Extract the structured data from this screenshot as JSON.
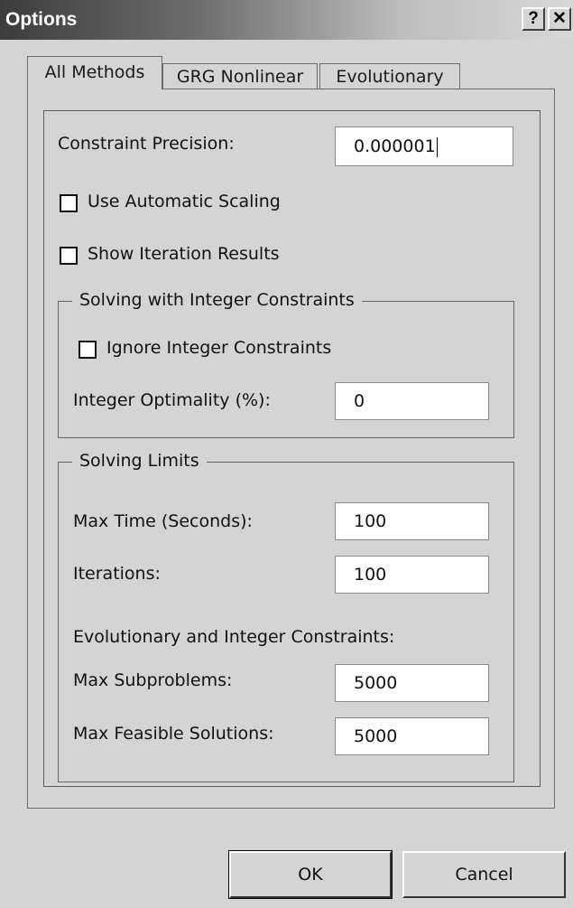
{
  "window": {
    "title": "Options",
    "help_btn": "?",
    "close_btn": "✕"
  },
  "tabs": [
    {
      "label": "All Methods",
      "active": true
    },
    {
      "label": "GRG Nonlinear",
      "active": false
    },
    {
      "label": "Evolutionary",
      "active": false
    }
  ],
  "constraint_precision": {
    "label": "Constraint Precision:",
    "value": "0.000001"
  },
  "checkboxes": {
    "use_automatic_scaling": {
      "label": "Use Automatic Scaling",
      "checked": false
    },
    "show_iteration_results": {
      "label": "Show Iteration Results",
      "checked": false
    }
  },
  "integer_group": {
    "legend": "Solving with Integer Constraints",
    "ignore_integer": {
      "label": "Ignore Integer Constraints",
      "checked": false
    },
    "integer_optimality": {
      "label": "Integer Optimality (%):",
      "value": "0"
    }
  },
  "limits_group": {
    "legend": "Solving Limits",
    "max_time": {
      "label": "Max Time (Seconds):",
      "value": "100"
    },
    "iterations": {
      "label": "Iterations:",
      "value": "100"
    },
    "evo_heading": "Evolutionary and Integer Constraints:",
    "max_subproblems": {
      "label": "Max Subproblems:",
      "value": "5000"
    },
    "max_feasible": {
      "label": "Max Feasible Solutions:",
      "value": "5000"
    }
  },
  "buttons": {
    "ok": "OK",
    "cancel": "Cancel"
  }
}
